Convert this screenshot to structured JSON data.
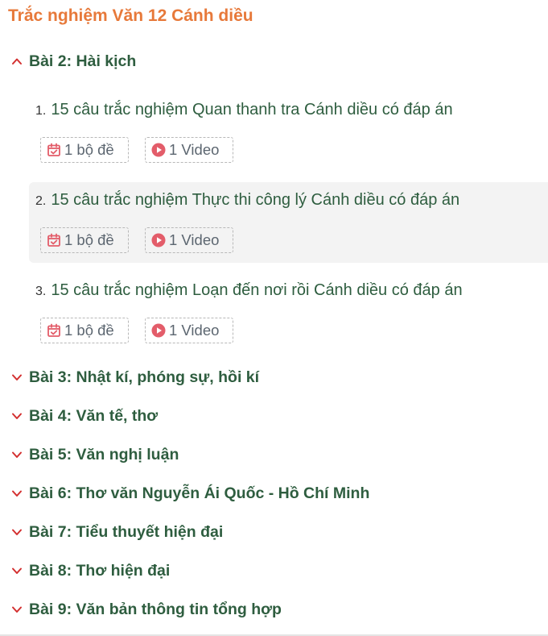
{
  "page_title": "Trắc nghiệm Văn 12 Cánh diều",
  "colors": {
    "title": "#e7793a",
    "heading": "#2e5d3f",
    "chevron": "#d32f2f",
    "icon": "#e35d6a"
  },
  "expanded_section": {
    "label": "Bài 2: Hài kịch",
    "lessons": [
      {
        "number": "1.",
        "title": "15 câu trắc nghiệm Quan thanh tra Cánh diều có đáp án",
        "quiz_badge": "1 bộ đề",
        "video_badge": "1 Video"
      },
      {
        "number": "2.",
        "title": "15 câu trắc nghiệm Thực thi công lý Cánh diều có đáp án",
        "quiz_badge": "1 bộ đề",
        "video_badge": "1 Video"
      },
      {
        "number": "3.",
        "title": "15 câu trắc nghiệm Loạn đến nơi rồi Cánh diều có đáp án",
        "quiz_badge": "1 bộ đề",
        "video_badge": "1 Video"
      }
    ]
  },
  "collapsed_sections": [
    "Bài 3: Nhật kí, phóng sự, hồi kí",
    "Bài 4: Văn tế, thơ",
    "Bài 5: Văn nghị luận",
    "Bài 6: Thơ văn Nguyễn Ái Quốc - Hồ Chí Minh",
    "Bài 7: Tiểu thuyết hiện đại",
    "Bài 8: Thơ hiện đại",
    "Bài 9: Văn bản thông tin tổng hợp"
  ]
}
